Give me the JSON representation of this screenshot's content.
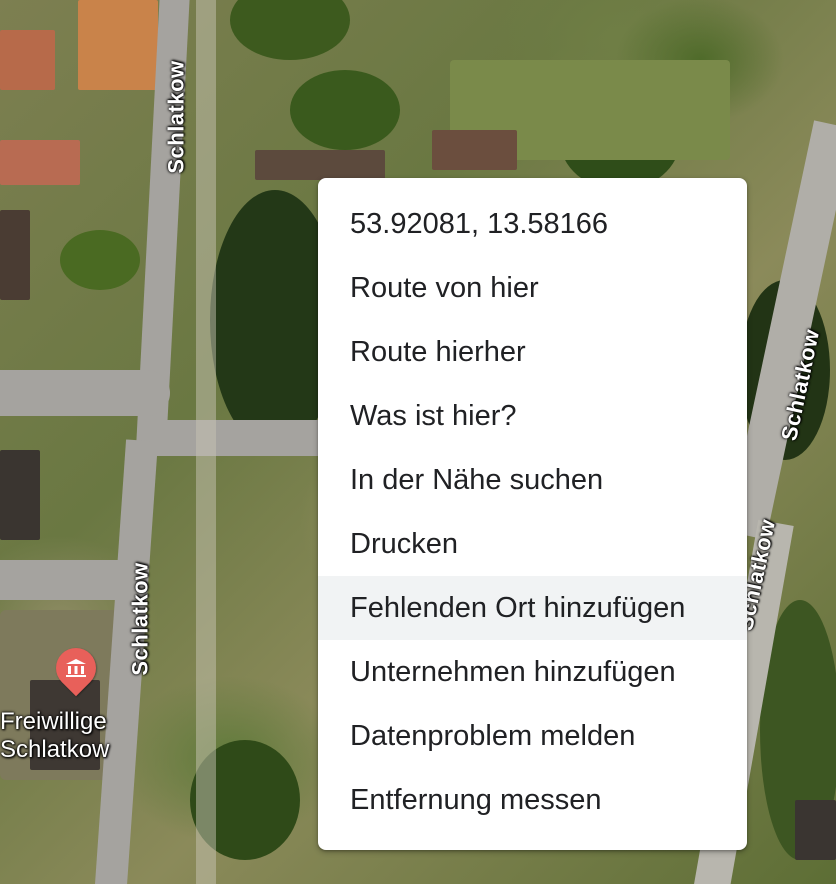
{
  "map": {
    "road_labels": [
      "Schlatkow",
      "Schlatkow",
      "Schlatkow",
      "Schlatkow"
    ],
    "poi": {
      "icon": "museum-icon",
      "label": "Freiwillige\nSchlatkow",
      "pin_color": "#e8605a"
    }
  },
  "context_menu": {
    "coordinates": "53.92081, 13.58166",
    "items": [
      "Route von hier",
      "Route hierher",
      "Was ist hier?",
      "In der Nähe suchen",
      "Drucken",
      "Fehlenden Ort hinzufügen",
      "Unternehmen hinzufügen",
      "Datenproblem melden",
      "Entfernung messen"
    ],
    "hovered_item": "Fehlenden Ort hinzufügen"
  }
}
